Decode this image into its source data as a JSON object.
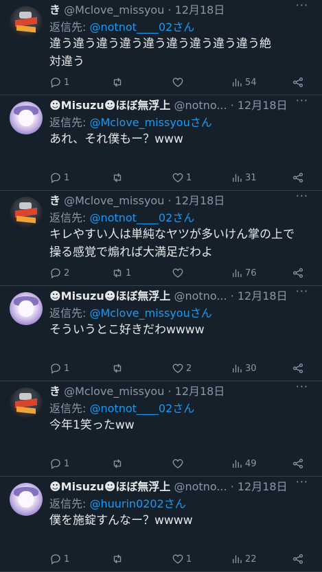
{
  "tweets": [
    {
      "avatar": "ki",
      "name": "き",
      "handle": "@Mclove_missyou",
      "date": "12月18日",
      "reply_prefix": "返信先: ",
      "reply_target": "@notnot____02さん",
      "text_lines": [
        "違う違う違う違う違う違う違う違う違う絶",
        "対違う"
      ],
      "replies": "1",
      "retweets": "",
      "likes": "",
      "views": "54"
    },
    {
      "avatar": "mi",
      "name": "☻Misuzu☻ほぼ無浮上",
      "handle": "@notno...",
      "date": "12月18日",
      "reply_prefix": "返信先: ",
      "reply_target": "@Mclove_missyouさん",
      "text_lines": [
        "あれ、それ僕もー？www"
      ],
      "replies": "1",
      "retweets": "",
      "likes": "1",
      "views": "31"
    },
    {
      "avatar": "ki",
      "name": "き",
      "handle": "@Mclove_missyou",
      "date": "12月18日",
      "reply_prefix": "返信先: ",
      "reply_target": "@notnot____02さん",
      "text_lines": [
        "キレやすい人は単純なヤツが多いけん掌の上で",
        "操る感覚で煽れば大満足だわよ"
      ],
      "replies": "2",
      "retweets": "1",
      "likes": "",
      "views": "76"
    },
    {
      "avatar": "mi",
      "name": "☻Misuzu☻ほぼ無浮上",
      "handle": "@notno...",
      "date": "12月18日",
      "reply_prefix": "返信先: ",
      "reply_target": "@Mclove_missyouさん",
      "text_lines": [
        "そういうとこ好きだわwwww"
      ],
      "replies": "1",
      "retweets": "",
      "likes": "2",
      "views": "30"
    },
    {
      "avatar": "ki",
      "name": "き",
      "handle": "@Mclove_missyou",
      "date": "12月18日",
      "reply_prefix": "返信先: ",
      "reply_target": "@notnot____02さん",
      "text_lines": [
        "今年1笑ったww"
      ],
      "replies": "1",
      "retweets": "",
      "likes": "",
      "views": "49"
    },
    {
      "avatar": "mi",
      "name": "☻Misuzu☻ほぼ無浮上",
      "handle": "@notno...",
      "date": "12月18日",
      "reply_prefix": "返信先: ",
      "reply_target": "@huurin0202さん",
      "text_lines": [
        "僕を施錠すんなー？wwww"
      ],
      "replies": "1",
      "retweets": "",
      "likes": "1",
      "views": "22"
    }
  ]
}
